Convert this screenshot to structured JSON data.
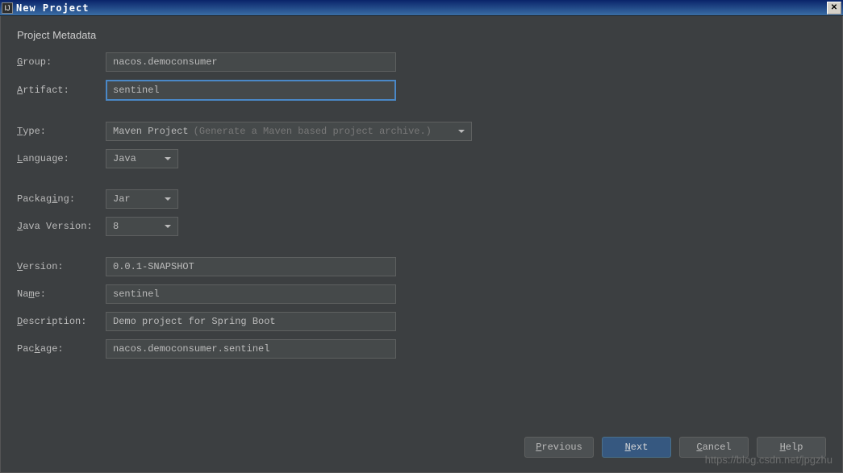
{
  "window": {
    "title": "New Project",
    "icon_label": "IJ"
  },
  "section_title": "Project Metadata",
  "labels": {
    "group": "roup:",
    "group_u": "G",
    "artifact": "rtifact:",
    "artifact_u": "A",
    "type": "ype:",
    "type_u": "T",
    "language": "anguage:",
    "language_u": "L",
    "packaging": "Packag",
    "packaging_after": "ng:",
    "packaging_u": "i",
    "java_version": "ava Version:",
    "java_version_u": "J",
    "version": "ersion:",
    "version_u": "V",
    "name": "Na",
    "name_after": "e:",
    "name_u": "m",
    "description": "escription:",
    "description_u": "D",
    "package": "Pac",
    "package_after": "age:",
    "package_u": "k"
  },
  "fields": {
    "group": "nacos.democonsumer",
    "artifact": "sentinel",
    "type": "Maven Project",
    "type_hint": "(Generate a Maven based project archive.)",
    "language": "Java",
    "packaging": "Jar",
    "java_version": "8",
    "version": "0.0.1-SNAPSHOT",
    "name": "sentinel",
    "description": "Demo project for Spring Boot",
    "package": "nacos.democonsumer.sentinel"
  },
  "buttons": {
    "previous": "revious",
    "previous_u": "P",
    "next": "ext",
    "next_u": "N",
    "cancel": "ancel",
    "cancel_u": "C",
    "help": "elp",
    "help_u": "H"
  },
  "watermark": "https://blog.csdn.net/jpgzhu"
}
